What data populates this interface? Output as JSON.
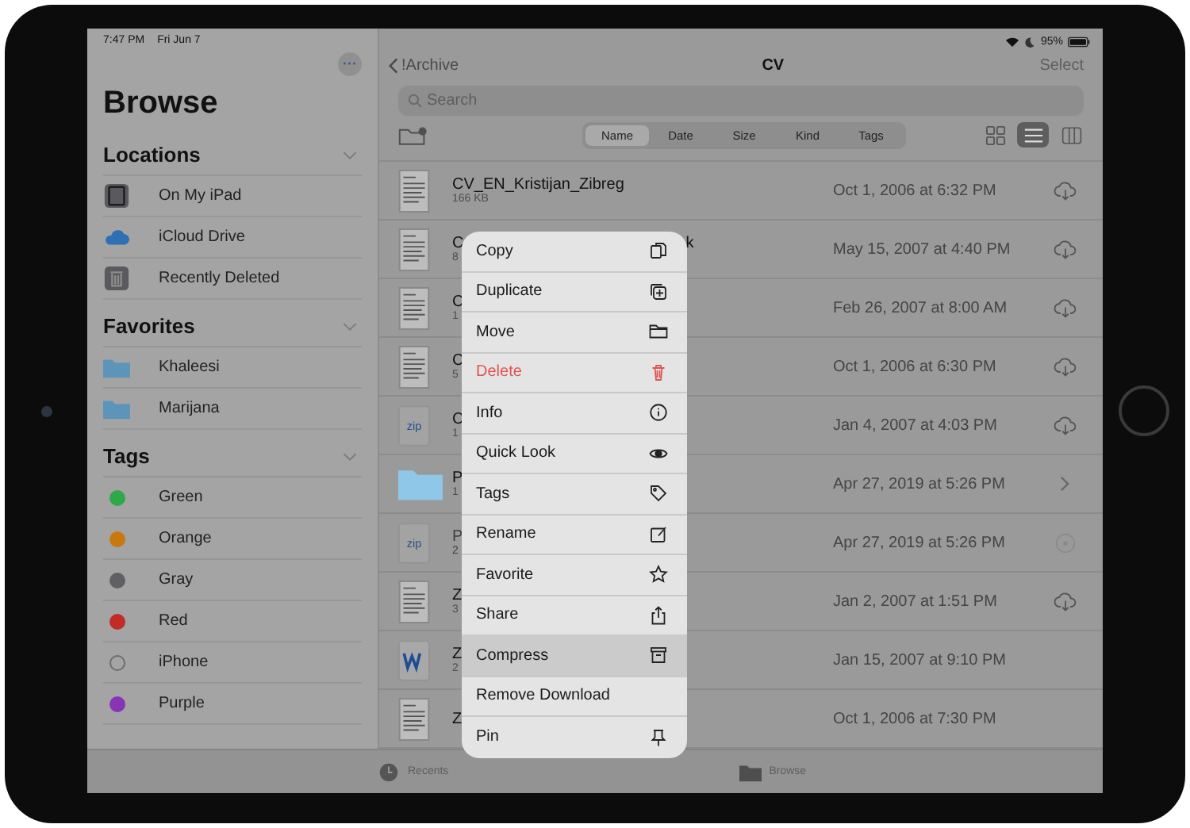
{
  "status_bar": {
    "time": "7:47 PM",
    "date": "Fri Jun 7",
    "battery_text": "95%"
  },
  "sidebar": {
    "title": "Browse",
    "more": "···",
    "sections": [
      {
        "title": "Locations",
        "items": [
          {
            "label": "On My iPad",
            "kind": "ipad"
          },
          {
            "label": "iCloud Drive",
            "kind": "cloud"
          },
          {
            "label": "Recently Deleted",
            "kind": "trash"
          }
        ]
      },
      {
        "title": "Favorites",
        "items": [
          {
            "label": "Khaleesi",
            "kind": "folder"
          },
          {
            "label": "Marijana",
            "kind": "folder"
          }
        ]
      },
      {
        "title": "Tags",
        "items": [
          {
            "label": "Green",
            "kind": "tag",
            "color": "#2fa84a"
          },
          {
            "label": "Orange",
            "kind": "tag",
            "color": "#c9780f"
          },
          {
            "label": "Gray",
            "kind": "tag",
            "color": "#5f5f64"
          },
          {
            "label": "Red",
            "kind": "tag",
            "color": "#c22c27"
          },
          {
            "label": "iPhone",
            "kind": "tag"
          },
          {
            "label": "Purple",
            "kind": "tag",
            "color": "#8a33b5"
          }
        ]
      }
    ]
  },
  "nav": {
    "back": "!Archive",
    "title": "CV",
    "action": "Select"
  },
  "search": {
    "placeholder": "Search"
  },
  "sort_tabs": [
    {
      "label": "Name",
      "selected": true
    },
    {
      "label": "Date",
      "selected": false
    },
    {
      "label": "Size",
      "selected": false
    },
    {
      "label": "Kind",
      "selected": false
    },
    {
      "label": "Tags",
      "selected": false
    }
  ],
  "view_modes": [
    {
      "kind": "grid",
      "selected": false
    },
    {
      "kind": "list",
      "selected": true
    },
    {
      "kind": "columns",
      "selected": false
    }
  ],
  "files": [
    {
      "kind": "doc",
      "name": "CV_EN_Kristijan_Zibreg",
      "size": "166 KB",
      "date": "Oct 1, 2006 at 6:32 PM",
      "trailing": {
        "kind": "cloud"
      }
    },
    {
      "kind": "doc",
      "name": "C",
      "name_tail": "k",
      "size": "8",
      "date": "May 15, 2007 at 4:40 PM",
      "trailing": {
        "kind": "cloud"
      }
    },
    {
      "kind": "doc",
      "name": "C",
      "size": "1",
      "date": "Feb 26, 2007 at 8:00 AM",
      "trailing": {
        "kind": "cloud"
      }
    },
    {
      "kind": "doc",
      "name": "C",
      "size": "5",
      "date": "Oct 1, 2006 at 6:30 PM",
      "trailing": {
        "kind": "cloud"
      }
    },
    {
      "kind": "zip",
      "name": "C",
      "size": "1",
      "date": "Jan 4, 2007 at 4:03 PM",
      "trailing": {
        "kind": "cloud"
      }
    },
    {
      "kind": "folder",
      "name": "P",
      "size": "1",
      "date": "Apr 27, 2019 at 5:26 PM",
      "trailing": {
        "kind": "chevron"
      }
    },
    {
      "kind": "zip",
      "name": "P",
      "size": "2",
      "date": "Apr 27, 2019 at 5:26 PM",
      "trailing": {
        "kind": "progress"
      },
      "disabled": true
    },
    {
      "kind": "doc",
      "name": "Z",
      "size": "3",
      "date": "Jan 2, 2007 at 1:51 PM",
      "trailing": {
        "kind": "cloud"
      }
    },
    {
      "kind": "word",
      "name": "Z",
      "size": "2",
      "date": "Jan 15, 2007 at 9:10 PM"
    },
    {
      "kind": "doc",
      "name": "Z",
      "date": "Oct 1, 2006 at 7:30 PM"
    }
  ],
  "context_menu": [
    {
      "label": "Copy",
      "destructive": false,
      "highlighted": false
    },
    {
      "label": "Duplicate",
      "destructive": false,
      "highlighted": false
    },
    {
      "label": "Move",
      "destructive": false,
      "highlighted": false
    },
    {
      "label": "Delete",
      "destructive": true,
      "highlighted": false
    },
    {
      "label": "Info",
      "destructive": false,
      "highlighted": false
    },
    {
      "label": "Quick Look",
      "destructive": false,
      "highlighted": false
    },
    {
      "label": "Tags",
      "destructive": false,
      "highlighted": false
    },
    {
      "label": "Rename",
      "destructive": false,
      "highlighted": false
    },
    {
      "label": "Favorite",
      "destructive": false,
      "highlighted": false
    },
    {
      "label": "Share",
      "destructive": false,
      "highlighted": false
    },
    {
      "label": "Compress",
      "destructive": false,
      "highlighted": true
    },
    {
      "label": "Remove Download",
      "destructive": false,
      "highlighted": false
    },
    {
      "label": "Pin",
      "destructive": false,
      "highlighted": false
    }
  ],
  "tab_bar": [
    {
      "label": "Recents",
      "kind": "recents"
    },
    {
      "label": "Browse",
      "kind": "browse"
    }
  ]
}
